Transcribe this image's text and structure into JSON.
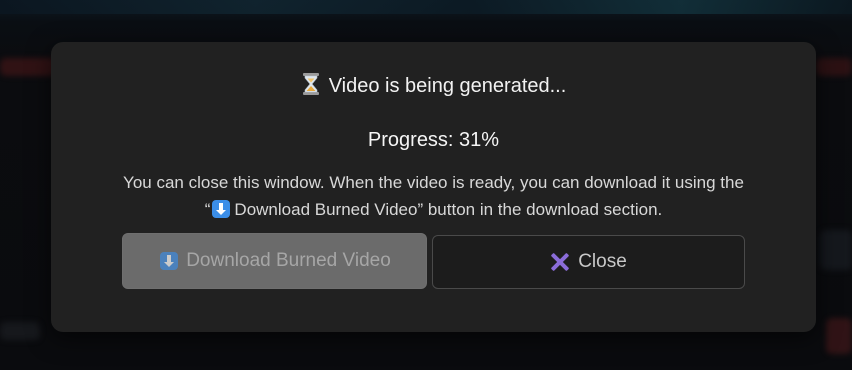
{
  "modal": {
    "title": "Video is being generated...",
    "title_icon": "hourglass-icon",
    "progress_text": "Progress: 31%",
    "progress_percent": 31,
    "info_line1": "You can close this window. When the video is ready, you can download it using the",
    "info_line2_open_quote": "“",
    "info_line2_button_name": "Download Burned Video",
    "info_line2_rest": "” button in the download section.",
    "download_button": {
      "label": "Download Burned Video",
      "icon": "down-arrow-icon",
      "disabled": true
    },
    "close_button": {
      "label": "Close",
      "icon": "close-icon"
    }
  },
  "colors": {
    "modal_bg": "#212121",
    "download_btn_bg": "#6b6b6b",
    "close_icon": "#8a6cd8",
    "emoji_blue": "#3b8ee8"
  }
}
